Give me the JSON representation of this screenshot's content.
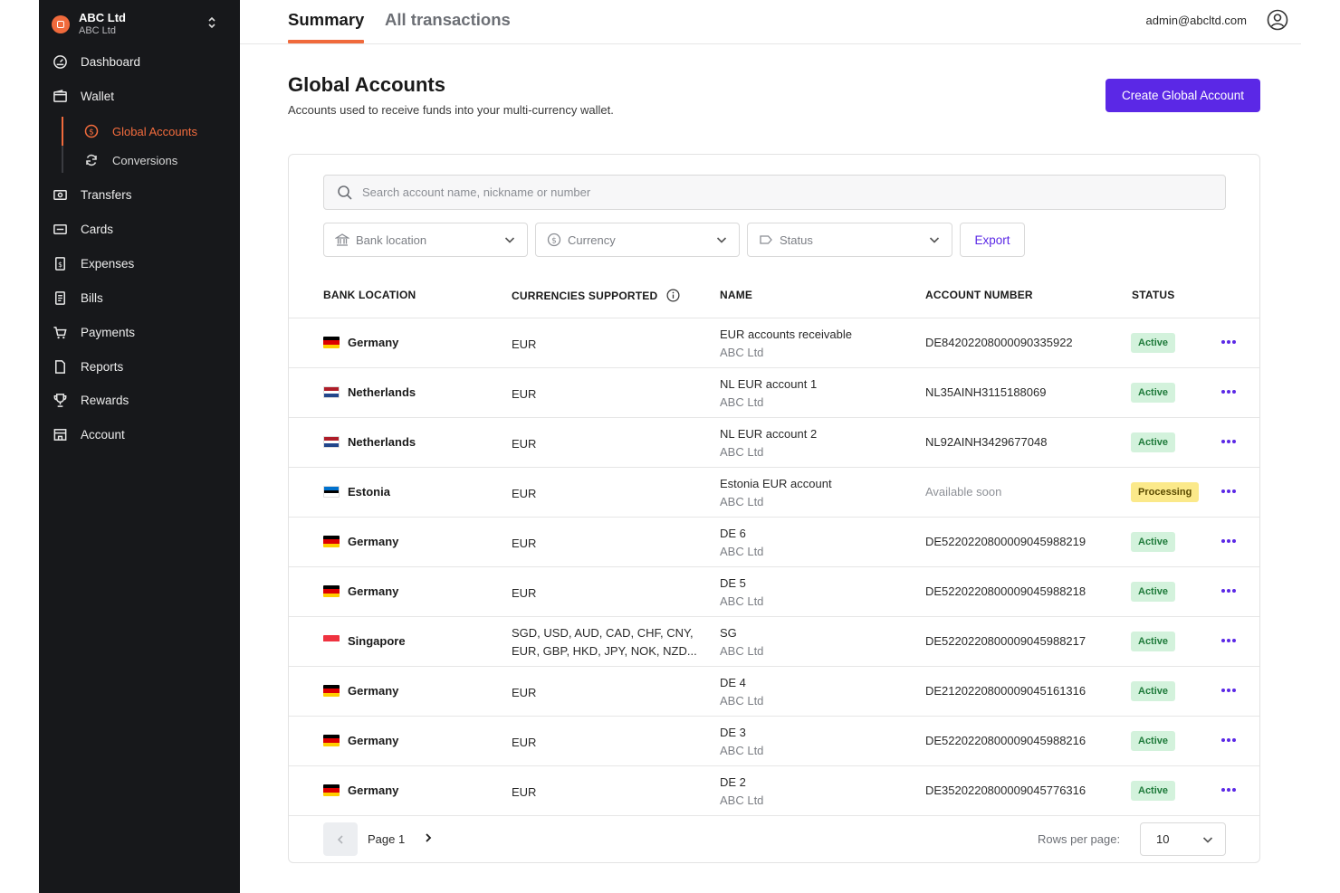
{
  "org": {
    "name": "ABC Ltd",
    "sub": "ABC Ltd"
  },
  "nav": {
    "dashboard": "Dashboard",
    "wallet": "Wallet",
    "global_accounts": "Global Accounts",
    "conversions": "Conversions",
    "transfers": "Transfers",
    "cards": "Cards",
    "expenses": "Expenses",
    "bills": "Bills",
    "payments": "Payments",
    "reports": "Reports",
    "rewards": "Rewards",
    "account": "Account"
  },
  "tabs": {
    "summary": "Summary",
    "all_transactions": "All transactions"
  },
  "user": {
    "email": "admin@abcltd.com"
  },
  "header": {
    "title": "Global Accounts",
    "subtitle": "Accounts used to receive funds into your multi-currency wallet.",
    "create_label": "Create Global Account"
  },
  "search": {
    "placeholder": "Search account name, nickname or number"
  },
  "filters": {
    "bank_location": "Bank location",
    "currency": "Currency",
    "status": "Status",
    "export": "Export"
  },
  "table": {
    "headers": {
      "bank_location": "BANK LOCATION",
      "currencies": "CURRENCIES SUPPORTED",
      "name": "NAME",
      "account_number": "ACCOUNT NUMBER",
      "status": "STATUS"
    },
    "rows": [
      {
        "country": "Germany",
        "currencies": "EUR",
        "currencies2": "",
        "name": "EUR accounts receivable",
        "owner": "ABC Ltd",
        "account": "DE84202208000090335922",
        "status": "Active"
      },
      {
        "country": "Netherlands",
        "currencies": "EUR",
        "currencies2": "",
        "name": "NL EUR account 1",
        "owner": "ABC Ltd",
        "account": "NL35AINH3115188069",
        "status": "Active"
      },
      {
        "country": "Netherlands",
        "currencies": "EUR",
        "currencies2": "",
        "name": "NL EUR account 2",
        "owner": "ABC Ltd",
        "account": "NL92AINH3429677048",
        "status": "Active"
      },
      {
        "country": "Estonia",
        "currencies": "EUR",
        "currencies2": "",
        "name": "Estonia EUR account",
        "owner": "ABC Ltd",
        "account": "Available soon",
        "status": "Processing"
      },
      {
        "country": "Germany",
        "currencies": "EUR",
        "currencies2": "",
        "name": "DE 6",
        "owner": "ABC Ltd",
        "account": "DE52202208000090459882​19",
        "status": "Active"
      },
      {
        "country": "Germany",
        "currencies": "EUR",
        "currencies2": "",
        "name": "DE 5",
        "owner": "ABC Ltd",
        "account": "DE52202208000090459882​18",
        "status": "Active"
      },
      {
        "country": "Singapore",
        "currencies": "SGD, USD, AUD, CAD, CHF, CNY,",
        "currencies2": "EUR, GBP, HKD, JPY, NOK, NZD...",
        "name": "SG",
        "owner": "ABC Ltd",
        "account": "DE52202208000090459882​17",
        "status": "Active"
      },
      {
        "country": "Germany",
        "currencies": "EUR",
        "currencies2": "",
        "name": "DE 4",
        "owner": "ABC Ltd",
        "account": "DE21202208000090451613​16",
        "status": "Active"
      },
      {
        "country": "Germany",
        "currencies": "EUR",
        "currencies2": "",
        "name": "DE 3",
        "owner": "ABC Ltd",
        "account": "DE52202208000090459882​16",
        "status": "Active"
      },
      {
        "country": "Germany",
        "currencies": "EUR",
        "currencies2": "",
        "name": "DE 2",
        "owner": "ABC Ltd",
        "account": "DE35202208000090457763​16",
        "status": "Active"
      }
    ]
  },
  "pager": {
    "page_label": "Page 1",
    "rows_label": "Rows per page:",
    "rows_value": "10"
  },
  "colors": {
    "accent": "#5b28e6",
    "brand": "#f06a3c",
    "active_bg": "#d3f2dc",
    "processing_bg": "#fbe98a",
    "sidebar_bg": "#17181b"
  }
}
